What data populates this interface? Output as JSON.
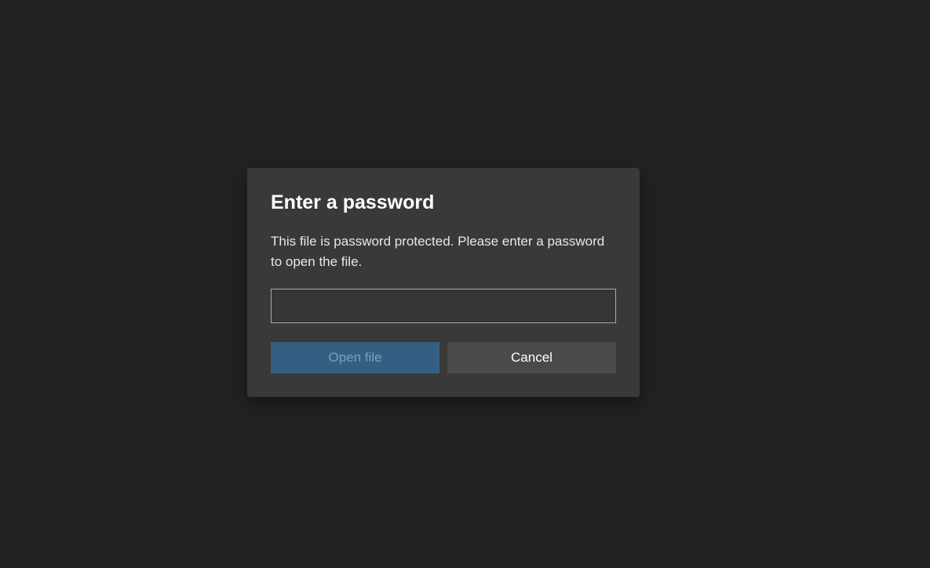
{
  "dialog": {
    "title": "Enter a password",
    "description": "This file is password protected. Please enter a password to open the file.",
    "password_value": "",
    "buttons": {
      "primary_label": "Open file",
      "secondary_label": "Cancel"
    }
  }
}
